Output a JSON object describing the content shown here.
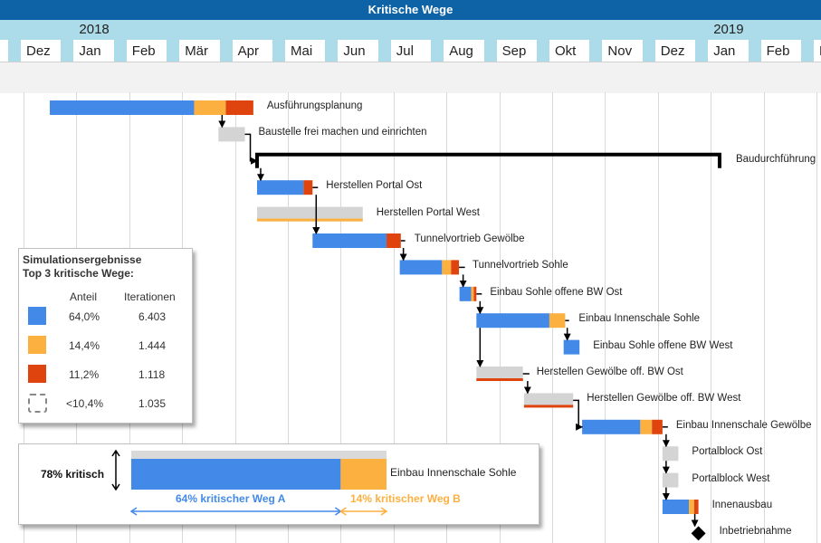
{
  "header": {
    "title": "Kritische Wege"
  },
  "timeline": {
    "years": [
      {
        "label": "2018",
        "month_index": 1
      },
      {
        "label": "2019",
        "month_index": 13
      }
    ],
    "months": [
      "Dez",
      "Jan",
      "Feb",
      "Mär",
      "Apr",
      "Mai",
      "Jun",
      "Jul",
      "Aug",
      "Sep",
      "Okt",
      "Nov",
      "Dez",
      "Jan",
      "Feb",
      "M"
    ]
  },
  "colors": {
    "blue": "#4389e8",
    "orange": "#fbb040",
    "red": "#e0440e",
    "gray": "#d4d4d4",
    "header": "#0d63a5",
    "year_band": "#acdce9",
    "link": "#000000"
  },
  "chart_data": {
    "type": "gantt",
    "title": "Kritische Wege",
    "time_unit": "month (0 = Dez 2017)",
    "tasks": [
      {
        "name": "Ausführungsplanung",
        "start": 0.48,
        "segments": [
          {
            "color": "blue",
            "length": 2.73
          },
          {
            "color": "orange",
            "length": 0.6
          },
          {
            "color": "red",
            "length": 0.52
          }
        ]
      },
      {
        "name": "Baustelle frei machen und einrichten",
        "start": 3.67,
        "segments": [
          {
            "color": "gray",
            "length": 0.5
          }
        ]
      },
      {
        "name": "Baudurchführung",
        "start": 4.4,
        "end": 13.15,
        "summary": true
      },
      {
        "name": "Herstellen Portal Ost",
        "start": 4.4,
        "segments": [
          {
            "color": "blue",
            "length": 0.88
          },
          {
            "color": "red",
            "length": 0.17
          }
        ]
      },
      {
        "name": "Herstellen Portal West",
        "start": 4.4,
        "segments": [
          {
            "color": "gray",
            "length": 2.0
          }
        ],
        "underline": "orange"
      },
      {
        "name": "Tunnelvortrieb Gewölbe",
        "start": 5.45,
        "segments": [
          {
            "color": "blue",
            "length": 1.4
          },
          {
            "color": "red",
            "length": 0.27
          }
        ]
      },
      {
        "name": "Tunnelvortrieb Sohle",
        "start": 7.1,
        "segments": [
          {
            "color": "blue",
            "length": 0.8
          },
          {
            "color": "orange",
            "length": 0.17
          },
          {
            "color": "red",
            "length": 0.15
          }
        ]
      },
      {
        "name": "Einbau Sohle offene BW Ost",
        "start": 8.23,
        "segments": [
          {
            "color": "blue",
            "length": 0.22
          },
          {
            "color": "orange",
            "length": 0.05
          },
          {
            "color": "red",
            "length": 0.05
          }
        ]
      },
      {
        "name": "Einbau Innenschale Sohle",
        "start": 8.55,
        "segments": [
          {
            "color": "blue",
            "length": 1.38
          },
          {
            "color": "orange",
            "length": 0.3
          }
        ]
      },
      {
        "name": "Einbau Sohle offene BW West",
        "start": 10.2,
        "segments": [
          {
            "color": "blue",
            "length": 0.3
          }
        ]
      },
      {
        "name": "Herstellen Gewölbe off. BW Ost",
        "start": 8.55,
        "segments": [
          {
            "color": "gray",
            "length": 0.88
          }
        ],
        "underline": "red"
      },
      {
        "name": "Herstellen Gewölbe off. BW West",
        "start": 9.45,
        "segments": [
          {
            "color": "gray",
            "length": 0.93
          }
        ],
        "underline": "red"
      },
      {
        "name": "Einbau Innenschale Gewölbe",
        "start": 10.55,
        "segments": [
          {
            "color": "blue",
            "length": 1.1
          },
          {
            "color": "orange",
            "length": 0.22
          },
          {
            "color": "red",
            "length": 0.2
          }
        ]
      },
      {
        "name": "Portalblock Ost",
        "start": 12.07,
        "segments": [
          {
            "color": "gray",
            "length": 0.3
          }
        ]
      },
      {
        "name": "Portalblock West",
        "start": 12.07,
        "segments": [
          {
            "color": "gray",
            "length": 0.3
          }
        ]
      },
      {
        "name": "Innenausbau",
        "start": 12.07,
        "segments": [
          {
            "color": "blue",
            "length": 0.5
          },
          {
            "color": "orange",
            "length": 0.1
          },
          {
            "color": "red",
            "length": 0.08
          }
        ]
      },
      {
        "name": "Inbetriebnahme",
        "start": 12.75,
        "milestone": true
      }
    ],
    "links": [
      [
        0,
        1
      ],
      [
        1,
        2
      ],
      [
        2,
        3
      ],
      [
        3,
        5
      ],
      [
        4,
        5
      ],
      [
        5,
        6
      ],
      [
        6,
        7
      ],
      [
        7,
        8
      ],
      [
        8,
        9
      ],
      [
        8,
        10
      ],
      [
        10,
        11
      ],
      [
        11,
        12
      ],
      [
        12,
        13
      ],
      [
        13,
        14
      ],
      [
        14,
        15
      ],
      [
        15,
        16
      ]
    ]
  },
  "legend": {
    "title_line1": "Simulationsergebnisse",
    "title_line2": "Top 3 kritische Wege:",
    "col_share": "Anteil",
    "col_iterations": "Iterationen",
    "rows": [
      {
        "swatch": "blue",
        "share": "64,0%",
        "iterations": "6.403"
      },
      {
        "swatch": "orange",
        "share": "14,4%",
        "iterations": "1.444"
      },
      {
        "swatch": "red",
        "share": "11,2%",
        "iterations": "1.118"
      },
      {
        "swatch": "dashed",
        "share": "<10,4%",
        "iterations": "1.035"
      }
    ]
  },
  "inset": {
    "critical_label": "78% kritisch",
    "task_label": "Einbau Innenschale Sohle",
    "path_a_label": "64% kritischer Weg A",
    "path_b_label": "14% kritischer Weg B",
    "path_a_share": 64,
    "path_b_share": 14,
    "total_critical": 78
  }
}
